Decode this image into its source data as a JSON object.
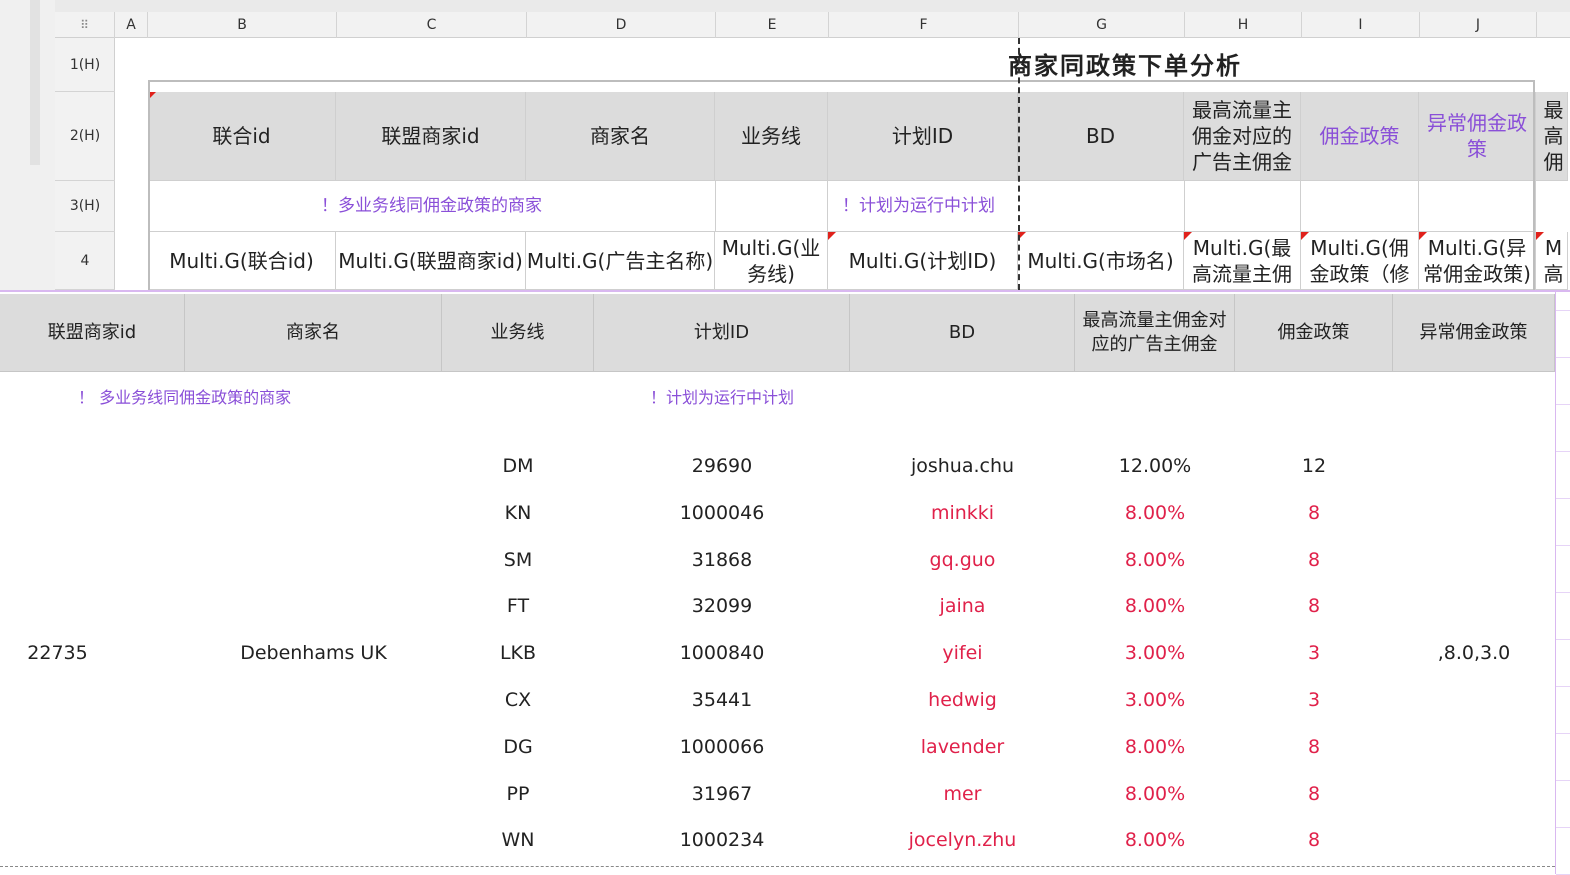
{
  "column_letters": [
    "A",
    "B",
    "C",
    "D",
    "E",
    "F",
    "G",
    "H",
    "I",
    "J"
  ],
  "row_labels": [
    "1(H)",
    "2(H)",
    "3(H)",
    "4"
  ],
  "sheet_title": "商家同政策下单分析",
  "template_headers": [
    "联合id",
    "联盟商家id",
    "商家名",
    "业务线",
    "计划ID",
    "BD",
    "最高流量主佣金对应的广告主佣金",
    "佣金政策",
    "异常佣金政策",
    "最高佣"
  ],
  "template_notes": {
    "multi_line": "！多业务线同佣金政策的商家",
    "running_plan": "！计划为运行中计划"
  },
  "template_formulas": [
    "Multi.G(联合id)",
    "Multi.G(联盟商家id)",
    "Multi.G(广告主名称)",
    "Multi.G(业务线)",
    "Multi.G(计划ID)",
    "Multi.G(市场名)",
    "Multi.G(最高流量主佣",
    "Multi.G(佣金政策（修",
    "Multi.G(异常佣金政策)",
    "M高"
  ],
  "preview": {
    "headers": [
      "联盟商家id",
      "商家名",
      "业务线",
      "计划ID",
      "BD",
      "最高流量主佣金对应的广告主佣金",
      "佣金政策",
      "异常佣金政策"
    ],
    "notes": {
      "multi_line": "！ 多业务线同佣金政策的商家",
      "running_plan": "！计划为运行中计划"
    },
    "merchant_id": "22735",
    "merchant_name": "Debenhams UK",
    "abnormal_policy": ",8.0,3.0",
    "rows": [
      {
        "line": "DM",
        "plan": "29690",
        "bd": "joshua.chu",
        "comm": "12.00%",
        "policy": "12"
      },
      {
        "line": "KN",
        "plan": "1000046",
        "bd": "minkki",
        "comm": "8.00%",
        "policy": "8"
      },
      {
        "line": "SM",
        "plan": "31868",
        "bd": "gq.guo",
        "comm": "8.00%",
        "policy": "8"
      },
      {
        "line": "FT",
        "plan": "32099",
        "bd": "jaina",
        "comm": "8.00%",
        "policy": "8"
      },
      {
        "line": "LKB",
        "plan": "1000840",
        "bd": "yifei",
        "comm": "3.00%",
        "policy": "3"
      },
      {
        "line": "CX",
        "plan": "35441",
        "bd": "hedwig",
        "comm": "3.00%",
        "policy": "3"
      },
      {
        "line": "DG",
        "plan": "1000066",
        "bd": "lavender",
        "comm": "8.00%",
        "policy": "8"
      },
      {
        "line": "PP",
        "plan": "31967",
        "bd": "mer",
        "comm": "8.00%",
        "policy": "8"
      },
      {
        "line": "WN",
        "plan": "1000234",
        "bd": "jocelyn.zhu",
        "comm": "8.00%",
        "policy": "8"
      }
    ]
  },
  "icons": {
    "grip": "grip-icon"
  },
  "colors": {
    "accent_purple": "#8a4fd8",
    "highlight_red": "#e0214a",
    "header_gray": "#dcdcdc"
  }
}
